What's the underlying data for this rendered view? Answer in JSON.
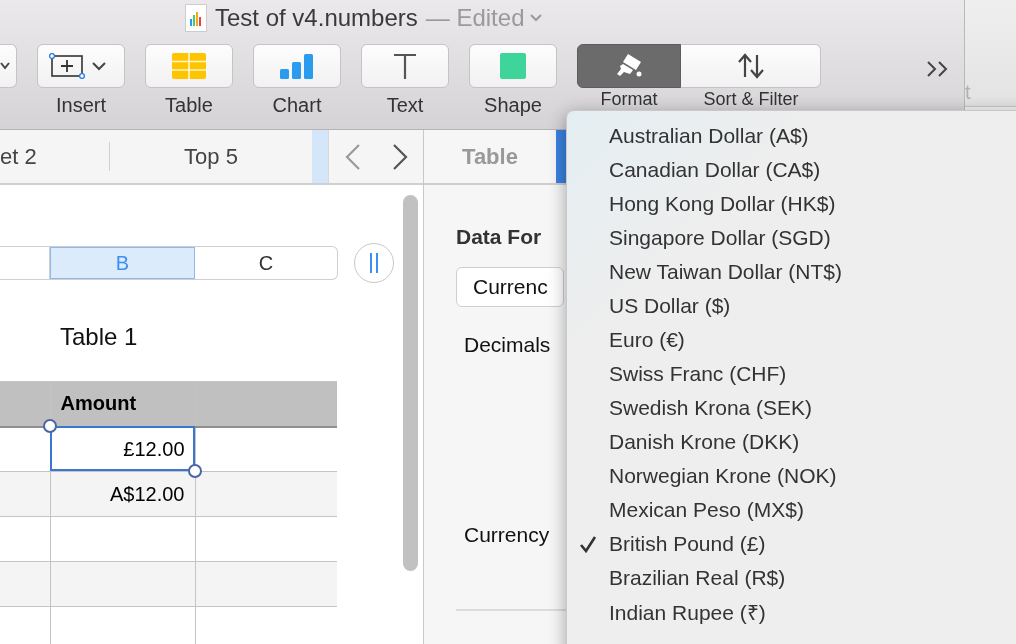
{
  "window": {
    "title": "Test of v4.numbers",
    "status": "— Edited"
  },
  "toolbar": {
    "buttons": [
      {
        "kind": "partial"
      },
      {
        "kind": "insert",
        "label": "Insert"
      },
      {
        "kind": "table",
        "label": "Table"
      },
      {
        "kind": "chart",
        "label": "Chart"
      },
      {
        "kind": "text",
        "label": "Text"
      },
      {
        "kind": "shape",
        "label": "Shape"
      },
      {
        "kind": "format",
        "label": "Format",
        "on": true
      },
      {
        "kind": "sort",
        "label": "Sort & Filter",
        "on": false
      }
    ]
  },
  "background_window": {
    "text": "t"
  },
  "sheet_tabs": [
    {
      "label": "et 2",
      "selected": false
    },
    {
      "label": "Top 5",
      "selected": false
    }
  ],
  "columns": [
    {
      "selected": false
    },
    {
      "label": "B",
      "selected": true
    },
    {
      "label": "C",
      "selected": false
    }
  ],
  "table": {
    "title": "Table 1",
    "header": "Amount",
    "rows": [
      {
        "amount": "£12.00",
        "selected": true
      },
      {
        "amount": "A$12.00",
        "selected": false
      },
      {
        "selected": false
      },
      {
        "selected": false
      },
      {
        "selected": false
      }
    ]
  },
  "inspector": {
    "tabs": [
      {
        "label": "Table",
        "selected": false
      }
    ],
    "heading": "Data For",
    "format_value": "Currenc",
    "decimals_label": "Decimals",
    "currency_label": "Currency"
  },
  "currency_menu": {
    "items": [
      {
        "label": "Australian Dollar (A$)",
        "checked": false
      },
      {
        "label": "Canadian Dollar (CA$)",
        "checked": false
      },
      {
        "label": "Hong Kong Dollar (HK$)",
        "checked": false
      },
      {
        "label": "Singapore Dollar (SGD)",
        "checked": false
      },
      {
        "label": "New Taiwan Dollar (NT$)",
        "checked": false
      },
      {
        "label": "US Dollar ($)",
        "checked": false
      },
      {
        "label": "Euro (€)",
        "checked": false
      },
      {
        "label": "Swiss Franc (CHF)",
        "checked": false
      },
      {
        "label": "Swedish Krona (SEK)",
        "checked": false
      },
      {
        "label": "Danish Krone (DKK)",
        "checked": false
      },
      {
        "label": "Norwegian Krone (NOK)",
        "checked": false
      },
      {
        "label": "Mexican Peso (MX$)",
        "checked": false
      },
      {
        "label": "British Pound (£)",
        "checked": true
      },
      {
        "label": "Brazilian Real (R$)",
        "checked": false
      },
      {
        "label": "Indian Rupee (₹)",
        "checked": false
      }
    ]
  }
}
